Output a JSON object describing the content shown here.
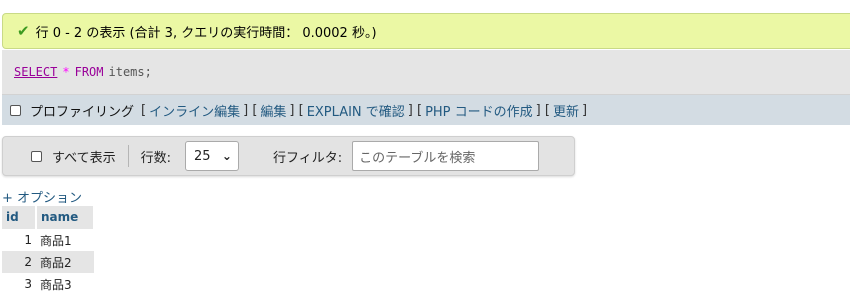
{
  "success": {
    "icon": "check-icon",
    "message": "行 0 - 2 の表示 (合計 3, クエリの実行時間： 0.0002 秒。)"
  },
  "sql": {
    "select": "SELECT",
    "star": "*",
    "from": "FROM",
    "table": "items;"
  },
  "toolbar": {
    "profiling_label": "プロファイリング",
    "links": [
      "インライン編集",
      "編集",
      "EXPLAIN で確認",
      "PHP コードの作成",
      "更新"
    ]
  },
  "navbar": {
    "show_all_label": "すべて表示",
    "rows_label": "行数:",
    "rows_value": "25",
    "filter_label": "行フィルタ:",
    "filter_placeholder": "このテーブルを検索"
  },
  "options_label": "+ オプション",
  "table": {
    "headers": [
      "id",
      "name"
    ],
    "rows": [
      {
        "id": "1",
        "name": "商品1"
      },
      {
        "id": "2",
        "name": "商品2"
      },
      {
        "id": "3",
        "name": "商品3"
      }
    ]
  },
  "colors": {
    "success_bg": "#ebf8a4",
    "link": "#235a81",
    "sql_keyword": "#990099"
  }
}
